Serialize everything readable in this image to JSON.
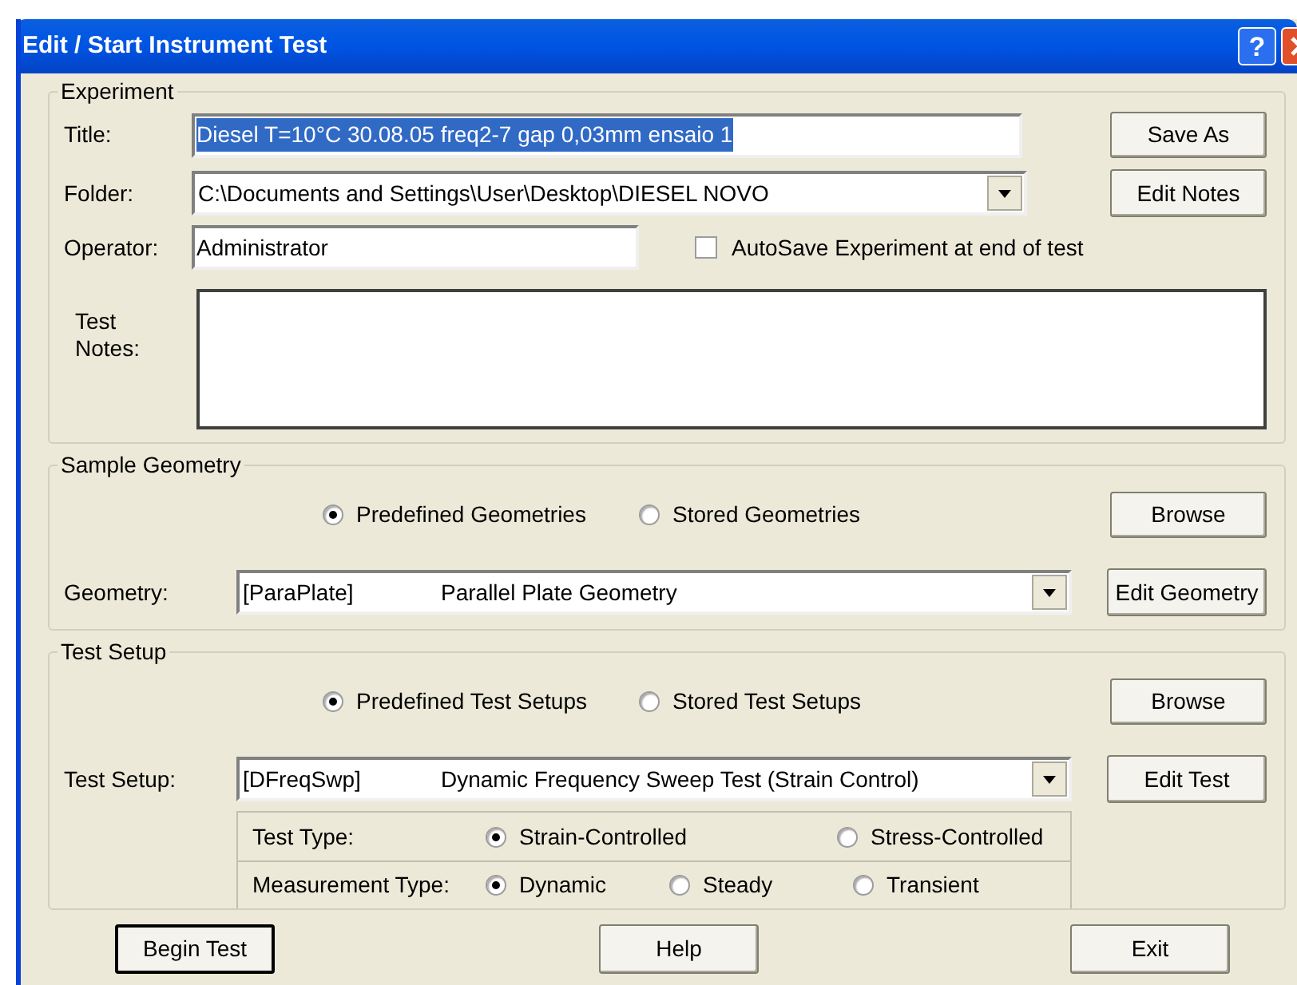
{
  "window": {
    "title": "Edit / Start Instrument Test",
    "help": "?"
  },
  "experiment": {
    "heading": "Experiment",
    "title": {
      "label": "Title:",
      "value": "Diesel T=10°C 30.08.05 freq2-7 gap 0,03mm ensaio 1",
      "selected": true
    },
    "folder": {
      "label": "Folder:",
      "value": "C:\\Documents and Settings\\User\\Desktop\\DIESEL NOVO"
    },
    "operator": {
      "label": "Operator:",
      "value": "Administrator"
    },
    "autosave": {
      "label": "AutoSave Experiment at end of test",
      "checked": false
    },
    "notes": {
      "label": "Test Notes:"
    },
    "buttons": [
      "Save As",
      "Edit Notes"
    ]
  },
  "geometry": {
    "heading": "Sample Geometry",
    "options": [
      {
        "label": "Predefined Geometries",
        "selected": true
      },
      {
        "label": "Stored Geometries",
        "selected": false
      }
    ],
    "browse": "Browse",
    "field": {
      "label": "Geometry:",
      "code": "[ParaPlate]",
      "name": "Parallel Plate Geometry"
    },
    "edit": "Edit Geometry"
  },
  "test_setup": {
    "heading": "Test Setup",
    "options": [
      {
        "label": "Predefined Test Setups",
        "selected": true
      },
      {
        "label": "Stored Test Setups",
        "selected": false
      }
    ],
    "browse": "Browse",
    "field": {
      "label": "Test Setup:",
      "code": "[DFreqSwp]",
      "name": "Dynamic Frequency Sweep Test (Strain Control)"
    },
    "edit": "Edit Test",
    "rows": [
      {
        "label": "Test Type:",
        "options": [
          {
            "label": "Strain-Controlled",
            "selected": true
          },
          {
            "label": "Stress-Controlled",
            "selected": false
          }
        ]
      },
      {
        "label": "Measurement Type:",
        "options": [
          {
            "label": "Dynamic",
            "selected": true
          },
          {
            "label": "Steady",
            "selected": false
          },
          {
            "label": "Transient",
            "selected": false
          }
        ]
      }
    ]
  },
  "buttons": [
    {
      "label": "Begin Test",
      "default": true
    },
    {
      "label": "Help",
      "default": false
    },
    {
      "label": "Exit",
      "default": false
    }
  ]
}
